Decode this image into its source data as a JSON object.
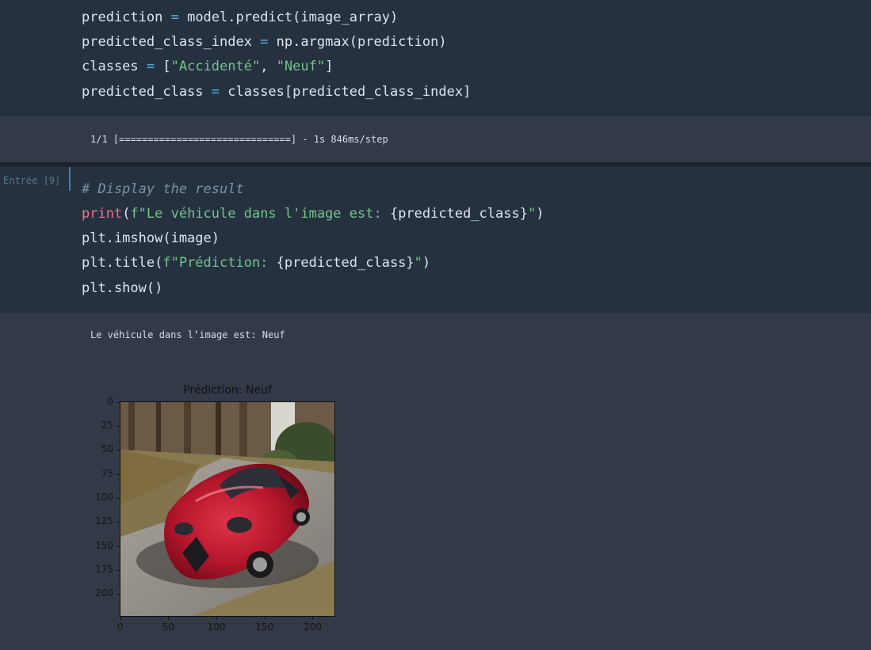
{
  "cell1": {
    "lines": [
      [
        [
          "prediction ",
          ""
        ],
        [
          "=",
          "op"
        ],
        [
          " model.predict(image_array)",
          ""
        ]
      ],
      [
        [
          "predicted_class_index ",
          ""
        ],
        [
          "=",
          "op"
        ],
        [
          " np.argmax(prediction)",
          ""
        ]
      ],
      [
        [
          "classes ",
          ""
        ],
        [
          "=",
          "op"
        ],
        [
          " [",
          ""
        ],
        [
          "\"Accidenté\"",
          "str"
        ],
        [
          ", ",
          ""
        ],
        [
          "\"Neuf\"",
          "str"
        ],
        [
          "]",
          ""
        ]
      ],
      [
        [
          "predicted_class ",
          ""
        ],
        [
          "=",
          "op"
        ],
        [
          " classes[predicted_class_index]",
          ""
        ]
      ]
    ],
    "output": "1/1 [==============================] - 1s 846ms/step"
  },
  "cell2": {
    "prompt": "Entrée [9]",
    "lines": [
      [
        [
          "# Display the result",
          "comment"
        ]
      ],
      [
        [
          "print",
          "kw"
        ],
        [
          "(",
          ""
        ],
        [
          "f\"Le véhicule dans l'image est: ",
          "str"
        ],
        [
          "{predicted_class}",
          ""
        ],
        [
          "\"",
          "str"
        ],
        [
          ")",
          ""
        ]
      ],
      [
        [
          "plt.imshow(image)",
          ""
        ]
      ],
      [
        [
          "plt.title(",
          ""
        ],
        [
          "f\"Prédiction: ",
          "str"
        ],
        [
          "{predicted_class}",
          ""
        ],
        [
          "\"",
          "str"
        ],
        [
          ")",
          ""
        ]
      ],
      [
        [
          "plt.show()",
          ""
        ]
      ]
    ],
    "output": "Le véhicule dans l’image est: Neuf"
  },
  "figure": {
    "title": "Prédiction: Neuf",
    "image_description_icon": "red-sports-car-photo",
    "y_ticks": [
      "0",
      "25",
      "50",
      "75",
      "100",
      "125",
      "150",
      "175",
      "200"
    ],
    "x_ticks": [
      "0",
      "50",
      "100",
      "150",
      "200"
    ],
    "image_size": 224
  },
  "colors": {
    "code_bg": "#263140",
    "output_bg": "#323a48",
    "operator": "#4fb4e8",
    "string": "#74c38a",
    "keyword": "#f06f8a",
    "comment": "#7d8fa8"
  }
}
